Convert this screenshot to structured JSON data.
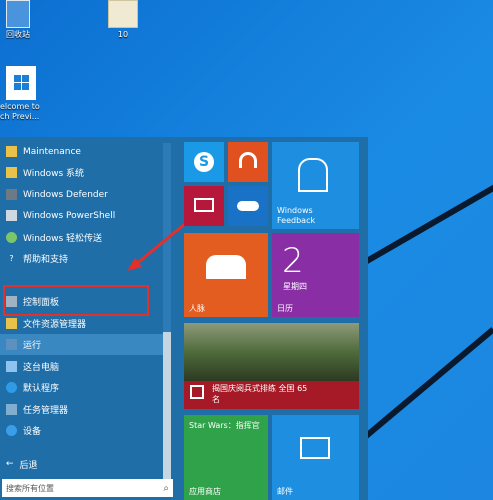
{
  "desktop": {
    "icons": [
      {
        "label": "回收站"
      },
      {
        "label": "10"
      },
      {
        "label_line1": "elcome to",
        "label_line2": "ch Previ..."
      }
    ]
  },
  "start_menu": {
    "items": [
      {
        "label": "Maintenance",
        "icon": "folder-icon"
      },
      {
        "label": "Windows 系统",
        "icon": "folder-icon"
      },
      {
        "label": "Windows Defender",
        "icon": "shield-icon"
      },
      {
        "label": "Windows PowerShell",
        "icon": "powershell-icon"
      },
      {
        "label": "Windows 轻松传送",
        "icon": "easy-transfer-icon"
      },
      {
        "label": "帮助和支持",
        "icon": "help-icon"
      },
      {
        "label": "控制面板",
        "icon": "control-panel-icon"
      },
      {
        "label": "文件资源管理器",
        "icon": "file-explorer-icon"
      },
      {
        "label": "运行",
        "icon": "run-icon"
      },
      {
        "label": "这台电脑",
        "icon": "computer-icon"
      },
      {
        "label": "默认程序",
        "icon": "default-programs-icon"
      },
      {
        "label": "任务管理器",
        "icon": "task-manager-icon"
      },
      {
        "label": "设备",
        "icon": "devices-icon"
      }
    ],
    "back_label": "后退",
    "search_placeholder": "搜索所有位置",
    "tiles": {
      "windows_feedback": "Windows Feedback",
      "people": "人脉",
      "calendar_day": "2",
      "calendar_weekday": "星期四",
      "calendar_label": "日历",
      "news_line1": "揭国庆阅兵式排练 全国 65",
      "news_line2": "名",
      "store_title": "Star Wars：指挥官",
      "store_label": "应用商店",
      "mail_label": "邮件"
    }
  }
}
